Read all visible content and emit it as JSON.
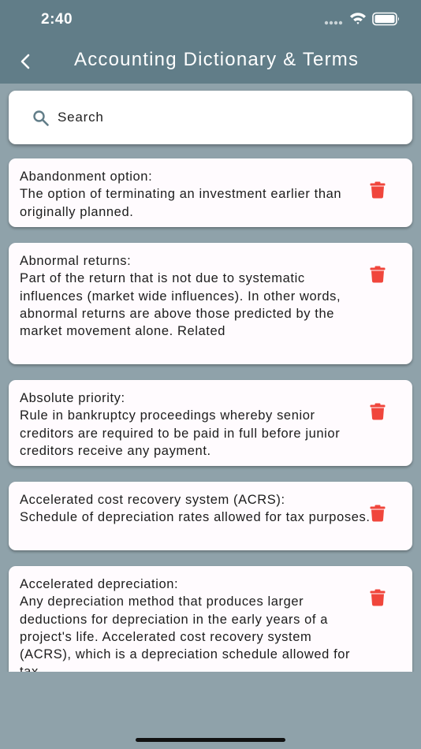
{
  "status_bar": {
    "time": "2:40"
  },
  "nav": {
    "title": "Accounting Dictionary & Terms"
  },
  "search": {
    "placeholder": "Search"
  },
  "terms": [
    {
      "term": "Abandonment option:",
      "definition": "The option of terminating an investment earlier than originally planned."
    },
    {
      "term": "Abnormal returns:",
      "definition": "Part of the return that is not due to systematic influences (market wide influences). In other words, abnormal returns are above those predicted by the market movement alone. Related"
    },
    {
      "term": "Absolute priority:",
      "definition": "Rule in bankruptcy proceedings whereby senior creditors are required to be paid in full before junior creditors receive any payment."
    },
    {
      "term": "Accelerated cost recovery system (ACRS):",
      "definition": "Schedule of depreciation rates allowed for tax purposes."
    },
    {
      "term": "Accelerated depreciation:",
      "definition": "Any depreciation method that produces larger deductions for depreciation in the early years of a project's life. Accelerated cost recovery system (ACRS), which is a depreciation schedule allowed for tax"
    }
  ],
  "colors": {
    "header": "#617d88",
    "background": "#8fa2aa",
    "delete": "#f0463c"
  }
}
